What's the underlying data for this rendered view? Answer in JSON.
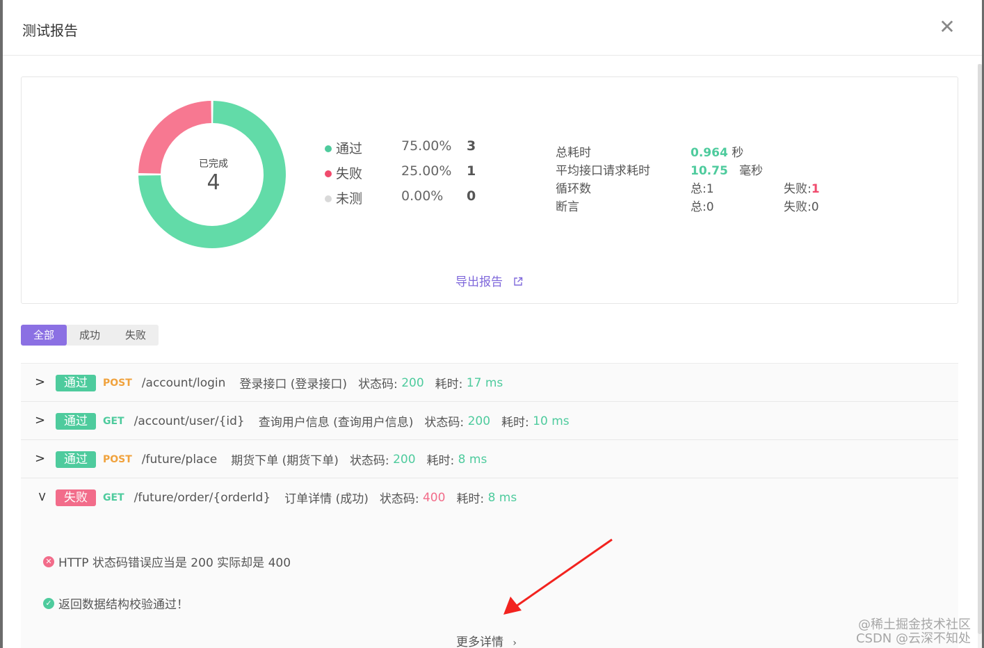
{
  "modal": {
    "title": "测试报告"
  },
  "summary": {
    "completed_label": "已完成",
    "completed_count": "4",
    "chart_data": {
      "type": "pie",
      "categories": [
        "通过",
        "失败",
        "未测"
      ],
      "values": [
        75.0,
        25.0,
        0.0
      ],
      "colors": [
        "#62dba8",
        "#f77891",
        "#dddddd"
      ]
    },
    "legend": [
      {
        "label": "通过",
        "pct": "75.00%",
        "count": "3",
        "color": "#4ecb9d"
      },
      {
        "label": "失败",
        "pct": "25.00%",
        "count": "1",
        "color": "#f04b6d"
      },
      {
        "label": "未测",
        "pct": "0.00%",
        "count": "0",
        "color": "#d9d9d9"
      }
    ],
    "stats": {
      "total_time_label": "总耗时",
      "total_time_value": "0.964",
      "total_time_unit": "秒",
      "avg_time_label": "平均接口请求耗时",
      "avg_time_value": "10.75",
      "avg_time_unit": "毫秒",
      "loop_label": "循环数",
      "loop_total": "总:1",
      "loop_fail_label": "失败:",
      "loop_fail_value": "1",
      "assert_label": "断言",
      "assert_total": "总:0",
      "assert_fail": "失败:0"
    },
    "export_label": "导出报告"
  },
  "filters": {
    "all": "全部",
    "success": "成功",
    "fail": "失败"
  },
  "requests": [
    {
      "status": "通过",
      "method": "POST",
      "path": "/account/login",
      "name": "登录接口 (登录接口)",
      "code_label": "状态码:",
      "code": "200",
      "time_label": "耗时:",
      "time": "17 ms"
    },
    {
      "status": "通过",
      "method": "GET",
      "path": "/account/user/{id}",
      "name": "查询用户信息 (查询用户信息)",
      "code_label": "状态码:",
      "code": "200",
      "time_label": "耗时:",
      "time": "10 ms"
    },
    {
      "status": "通过",
      "method": "POST",
      "path": "/future/place",
      "name": "期货下单 (期货下单)",
      "code_label": "状态码:",
      "code": "200",
      "time_label": "耗时:",
      "time": "8 ms"
    },
    {
      "status": "失败",
      "method": "GET",
      "path": "/future/order/{orderId}",
      "name": "订单详情 (成功)",
      "code_label": "状态码:",
      "code": "400",
      "time_label": "耗时:",
      "time": "8 ms"
    }
  ],
  "detail": {
    "assert_fail": "HTTP 状态码错误应当是 200 实际却是 400",
    "assert_pass": "返回数据结构校验通过！",
    "more_label": "更多详情"
  },
  "watermark": {
    "line1": "@稀土掘金技术社区",
    "line2": "CSDN @云深不知处"
  }
}
